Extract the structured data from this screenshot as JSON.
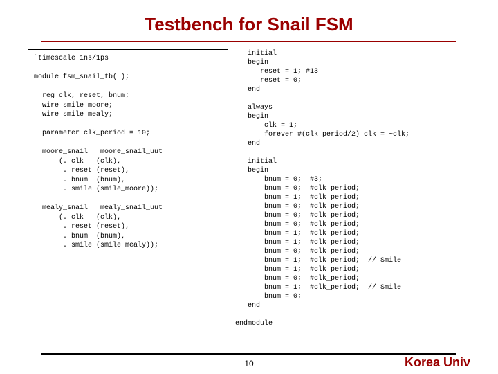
{
  "title": "Testbench for Snail FSM",
  "code_left": "`timescale 1ns/1ps\n\nmodule fsm_snail_tb( );\n\n  reg clk, reset, bnum;\n  wire smile_moore;\n  wire smile_mealy;\n\n  parameter clk_period = 10;\n\n  moore_snail   moore_snail_uut\n      (. clk   (clk),\n       . reset (reset),\n       . bnum  (bnum),\n       . smile (smile_moore));\n\n  mealy_snail   mealy_snail_uut\n      (. clk   (clk),\n       . reset (reset),\n       . bnum  (bnum),\n       . smile (smile_mealy));",
  "code_right": "   initial\n   begin\n      reset = 1; #13\n      reset = 0;\n   end\n\n   always\n   begin\n       clk = 1;\n       forever #(clk_period/2) clk = ~clk;\n   end\n\n   initial\n   begin\n       bnum = 0;  #3;\n       bnum = 0;  #clk_period;\n       bnum = 1;  #clk_period;\n       bnum = 0;  #clk_period;\n       bnum = 0;  #clk_period;\n       bnum = 0;  #clk_period;\n       bnum = 1;  #clk_period;\n       bnum = 1;  #clk_period;\n       bnum = 0;  #clk_period;\n       bnum = 1;  #clk_period;  // Smile\n       bnum = 1;  #clk_period;\n       bnum = 0;  #clk_period;\n       bnum = 1;  #clk_period;  // Smile\n       bnum = 0;\n   end\n\nendmodule",
  "page_number": "10",
  "footer": "Korea Univ"
}
